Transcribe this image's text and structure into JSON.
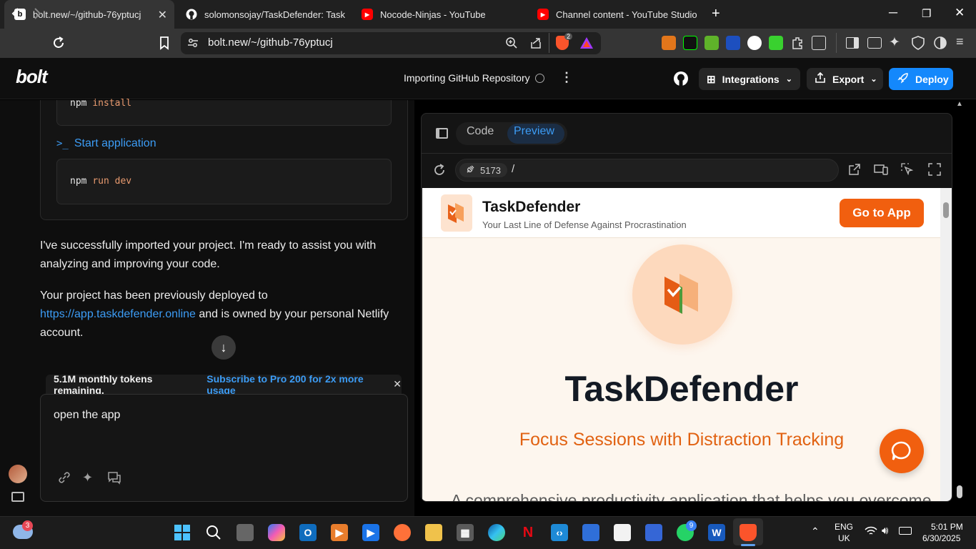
{
  "browser": {
    "tabs": [
      {
        "label": "bolt.new/~/github-76yptucj",
        "active": true,
        "icon": "bolt-favicon"
      },
      {
        "label": "solomonsojay/TaskDefender: TaskDef",
        "active": false,
        "icon": "github-favicon"
      },
      {
        "label": "Nocode-Ninjas - YouTube",
        "active": false,
        "icon": "youtube-favicon"
      },
      {
        "label": "Channel content - YouTube Studio",
        "active": false,
        "icon": "youtube-studio-favicon"
      }
    ],
    "new_tab": "+",
    "url": "bolt.new/~/github-76yptucj",
    "brave_badge": "2"
  },
  "bolt": {
    "logo": "bolt",
    "project_title": "Importing GitHub Repository",
    "integrations_label": "Integrations",
    "export_label": "Export",
    "deploy_label": "Deploy"
  },
  "chat": {
    "install_cmd_prefix": "npm ",
    "install_cmd_arg": "install",
    "start_app_label": "Start application",
    "start_app_glyph": ">_",
    "run_cmd_prefix": "npm ",
    "run_cmd_arg": "run dev",
    "msg1": "I've successfully imported your project. I'm ready to assist you with analyzing and improving your code.",
    "msg2_before": "Your project has been previously deployed to",
    "msg2_link": "https://app.taskdefender.online",
    "msg2_after": " and is owned by your personal Netlify account.",
    "tokens_text": "5.1M monthly tokens remaining.",
    "subscribe_text": "Subscribe to Pro 200 for 2x more usage",
    "input_value": "open the app"
  },
  "workbench": {
    "tab_code": "Code",
    "tab_preview": "Preview",
    "port": "5173",
    "path": "/"
  },
  "preview": {
    "brand": "TaskDefender",
    "tagline": "Your Last Line of Defense Against Procrastination",
    "go_to_app": "Go to App",
    "hero_title": "TaskDefender",
    "hero_subtitle": "Focus Sessions with Distraction Tracking",
    "hero_desc": "A comprehensive productivity application that helps you overcome",
    "accent": "#f15f0f"
  },
  "taskbar": {
    "weather_badge": "3",
    "whatsapp_badge": "9",
    "lang": "ENG",
    "region": "UK",
    "time": "5:01 PM",
    "date": "6/30/2025"
  }
}
